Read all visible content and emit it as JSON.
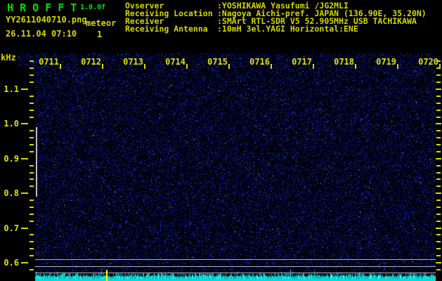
{
  "header": {
    "app_title": "H R O F F T",
    "version": "1.0.0f",
    "filename": "YY2611040710.png",
    "mode": "meteor",
    "datetime": "26.11.04 07:10",
    "echo_count": "1",
    "info_rows": [
      {
        "label": "Ovserver",
        "value": ":YOSHIKAWA Yasufumi /JG2MLI"
      },
      {
        "label": "Receiving Location",
        "value": ":Nagoya Aichi-pref. JAPAN (136.90E, 35.20N)"
      },
      {
        "label": "Receiver",
        "value": ":SMArt RTL-SDR V5 52.905MHz USB TACHIKAWA"
      },
      {
        "label": "Receiving Antenna",
        "value": ":10mH 3el.YAGI Horizontal:ENE"
      }
    ]
  },
  "chart_data": {
    "type": "heatmap",
    "title": "HROFFT 10-minute radio meteor spectrogram (background noise, one echo marker)",
    "x_axis": {
      "unit": "hhmm",
      "labels": [
        "0711",
        "0712",
        "0713",
        "0714",
        "0715",
        "0716",
        "0717",
        "0718",
        "0719",
        "0720"
      ]
    },
    "y_axis": {
      "unit": "kHz",
      "labels": [
        "1.1",
        "1.0",
        "0.9",
        "0.8",
        "0.7",
        "0.6"
      ],
      "top_khz": 1.18,
      "bottom_khz": 0.58,
      "minor_step_khz": 0.02
    },
    "reference_lines_khz": [
      0.609,
      0.589,
      0.57
    ],
    "calibration_bar_khz": [
      1.0,
      0.8
    ],
    "echo_spike": {
      "time": "0712",
      "note": "yellow event marker in bottom level strip"
    },
    "level_strip": "cyan signal-level trace along bottom edge",
    "colors": {
      "title_green": "#00dd00",
      "axis_yellow": "#d8d800",
      "text_yellow": "#d6d600",
      "noise_blue": "#1822cc",
      "bright_dot": "#9fd8ff",
      "level_strip_cyan": "#00dcdc",
      "grid_line_gray": "#b2b2b2",
      "calibration_bar": "#cbcbd6",
      "marker_yellow": "#ffff00"
    }
  }
}
